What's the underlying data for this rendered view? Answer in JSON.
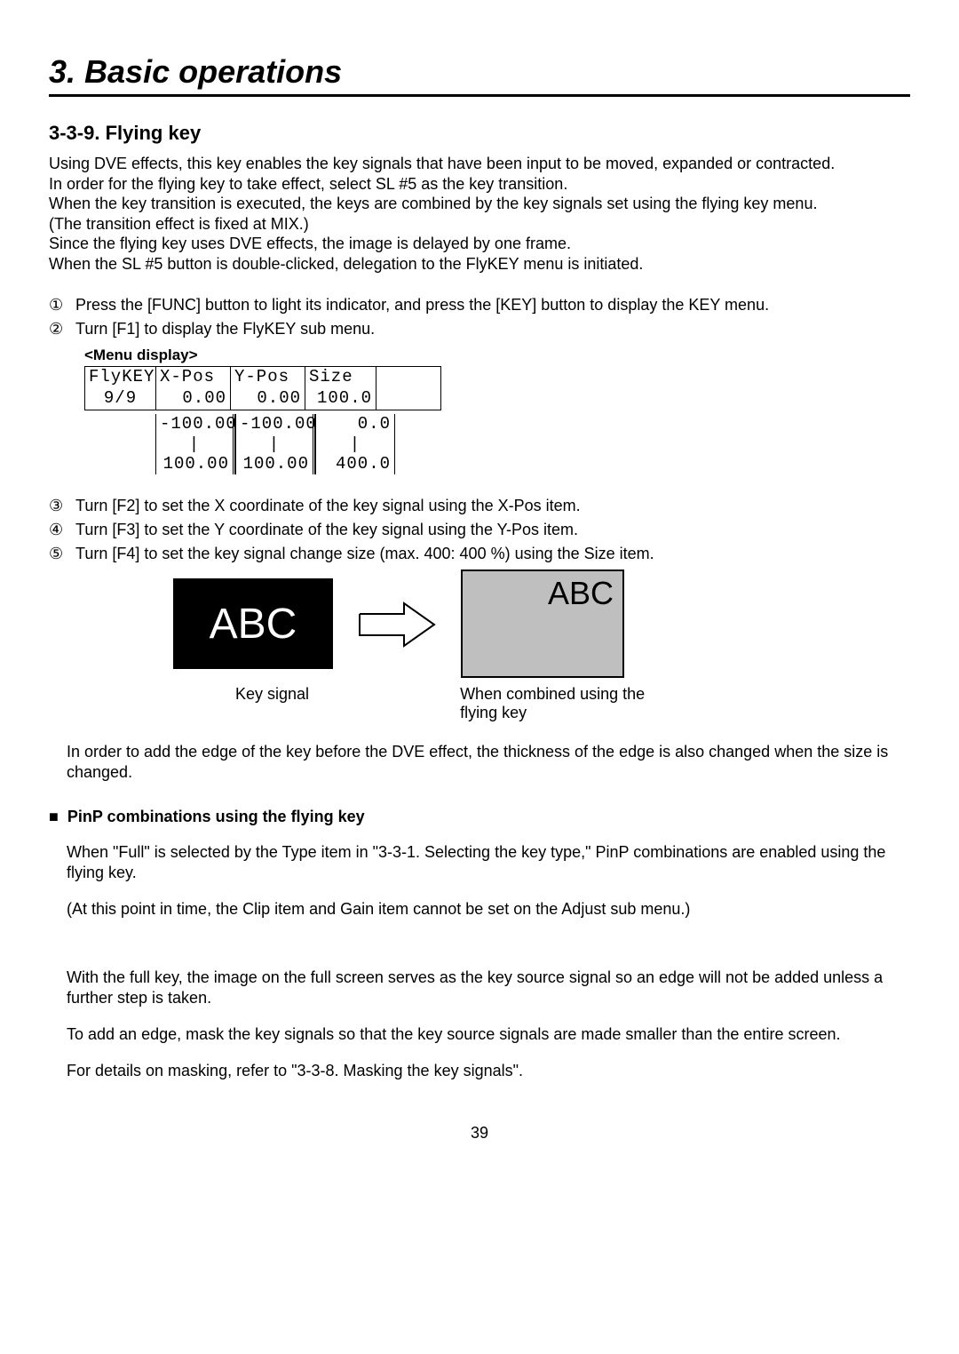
{
  "chapter_title": "3. Basic operations",
  "section_title": "3-3-9. Flying key",
  "intro": {
    "l1": "Using DVE effects, this key enables the key signals that have been input to be moved, expanded or contracted.",
    "l2": "In order for the flying key to take effect, select SL #5 as the key transition.",
    "l3": "When the key transition is executed, the keys are combined by the key signals set using the flying key menu.",
    "l4": "(The transition effect is fixed at MIX.)",
    "l5": "Since the flying key uses DVE effects, the image is delayed by one frame.",
    "l6": "When the SL #5 button is double-clicked, delegation to the FlyKEY menu is initiated."
  },
  "steps": [
    {
      "marker": "①",
      "text": "Press the [FUNC] button to light its indicator, and press the [KEY] button to display the KEY menu."
    },
    {
      "marker": "②",
      "text": "Turn [F1] to display the FlyKEY sub menu."
    },
    {
      "marker": "③",
      "text": "Turn [F2] to set the X coordinate of the key signal using the X-Pos item."
    },
    {
      "marker": "④",
      "text": "Turn [F3] to set the Y coordinate of the key signal using the Y-Pos item."
    },
    {
      "marker": "⑤",
      "text": "Turn [F4] to set the key signal change size (max. 400: 400 %) using the Size item."
    }
  ],
  "menu_display_label": "<Menu display>",
  "menu": {
    "header": {
      "name": "FlyKEY",
      "xpos": "X-Pos",
      "ypos": "Y-Pos",
      "size": "Size"
    },
    "values": {
      "page": "9/9",
      "xpos": "0.00",
      "ypos": "0.00",
      "size": "100.0"
    },
    "ranges": {
      "sep": "|",
      "xpos": {
        "min": "-100.00",
        "max": "100.00"
      },
      "ypos": {
        "min": "-100.00",
        "max": "100.00"
      },
      "size": {
        "min": "0.0",
        "max": "400.0"
      }
    }
  },
  "illustration": {
    "abc": "ABC",
    "caption_left": "Key signal",
    "caption_right": "When combined using the flying key"
  },
  "edge_note": "In order to add the edge of the key before the DVE effect, the thickness of the edge is also changed when the size is changed.",
  "pinp": {
    "heading": "PinP combinations using the flying key",
    "p1": "When \"Full\" is selected by the Type item in \"3-3-1. Selecting the key type,\" PinP combinations are enabled using the flying key.",
    "p2": "(At this point in time, the Clip item and Gain item cannot be set on the Adjust sub menu.)",
    "p3": "With the full key, the image on the full screen serves as the key source signal so an edge will not be added unless a further step is taken.",
    "p4": "To add an edge, mask the key signals so that the key source signals are made smaller than the entire screen.",
    "p5": "For details on masking, refer to \"3-3-8. Masking the key signals\"."
  },
  "page_number": "39"
}
